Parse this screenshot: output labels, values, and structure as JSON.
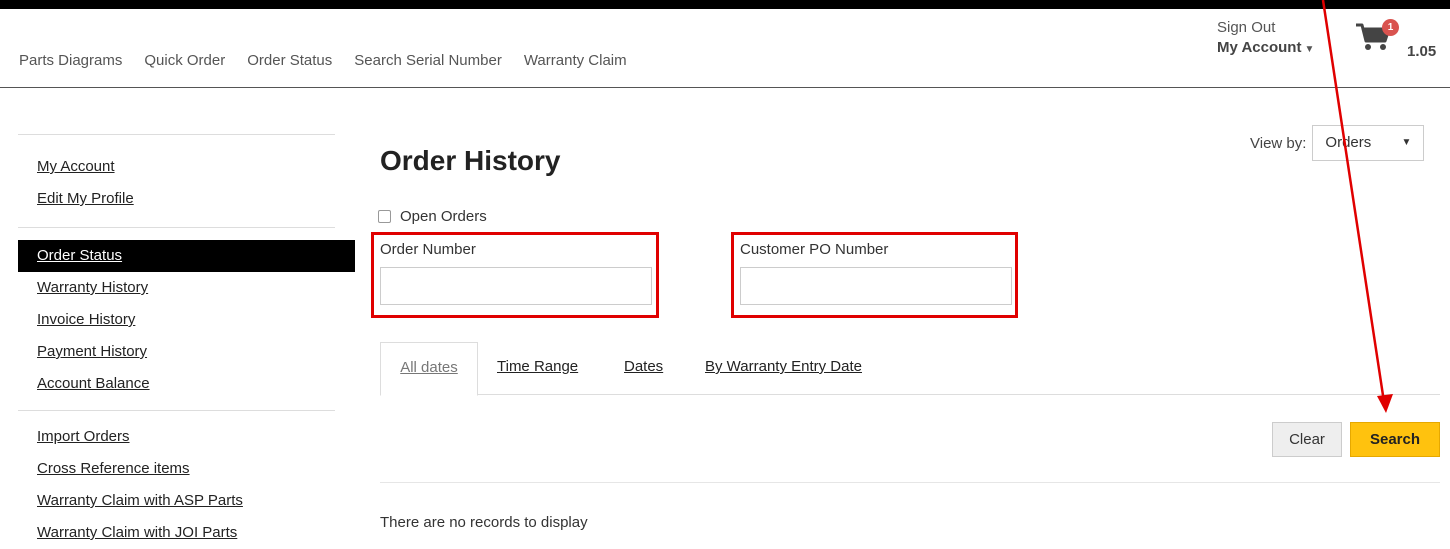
{
  "nav": {
    "links": [
      "Parts Diagrams",
      "Quick Order",
      "Order Status",
      "Search Serial Number",
      "Warranty Claim"
    ],
    "sign_out": "Sign Out",
    "my_account": "My Account",
    "cart_count": "1",
    "cart_total": "1.05"
  },
  "sidebar": {
    "group1": [
      "My Account",
      "Edit My Profile"
    ],
    "group2": [
      "Order Status",
      "Warranty History",
      "Invoice History",
      "Payment History",
      "Account Balance"
    ],
    "group3": [
      "Import Orders",
      "Cross Reference items",
      "Warranty Claim with ASP Parts",
      "Warranty Claim with JOI Parts"
    ],
    "active": "Order Status"
  },
  "main": {
    "title": "Order History",
    "view_by_label": "View by:",
    "view_by_value": "Orders",
    "open_orders_label": "Open Orders",
    "order_number_label": "Order Number",
    "order_number_value": "",
    "customer_po_label": "Customer PO Number",
    "customer_po_value": "",
    "tabs": [
      "All dates",
      "Time Range",
      "Dates",
      "By Warranty Entry Date"
    ],
    "active_tab": "All dates",
    "clear_label": "Clear",
    "search_label": "Search",
    "no_records": "There are no records to display"
  },
  "colors": {
    "search_button": "#ffc20e",
    "highlight_box": "#e00000",
    "active_sidebar": "#000000",
    "cart_badge": "#d9534f"
  },
  "icons": {
    "cart": "shopping-cart-icon",
    "dropdown": "caret-down-icon"
  }
}
